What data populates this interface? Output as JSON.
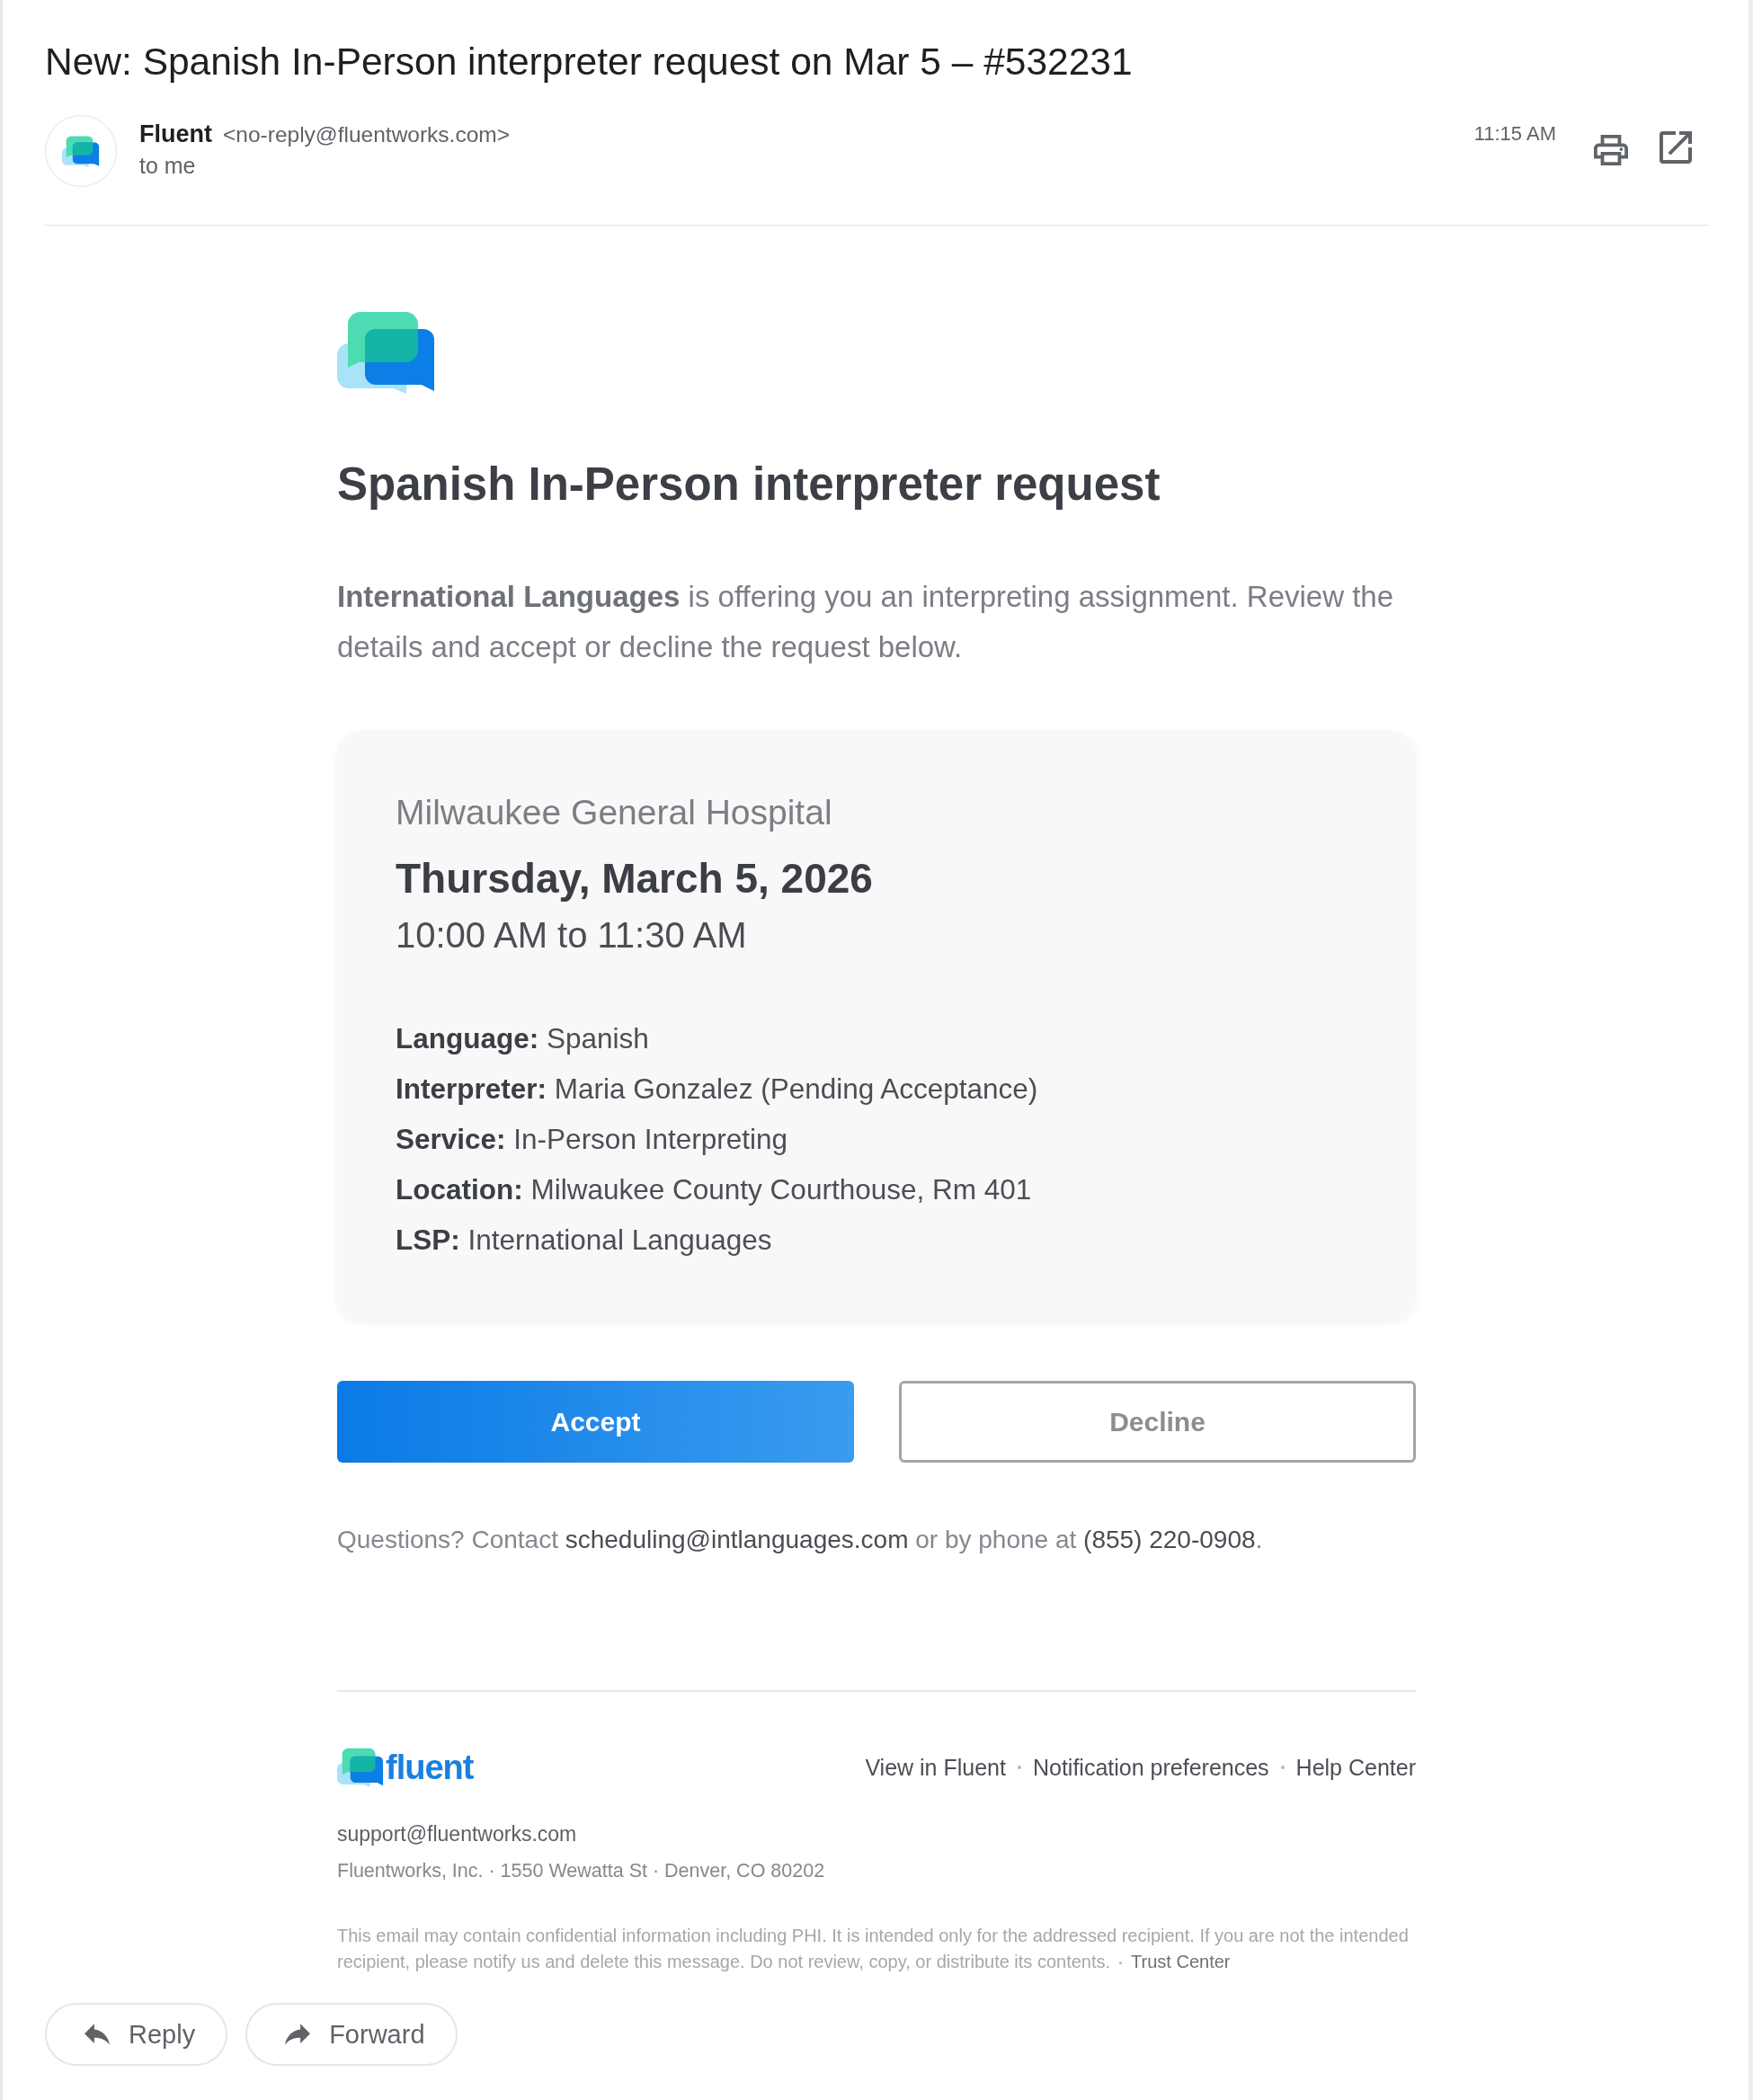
{
  "email": {
    "subject": "New: Spanish In-Person interpreter request on Mar 5 – #532231",
    "sender": {
      "name": "Fluent",
      "address": "<no-reply@fluentworks.com>",
      "recipient": "to me"
    },
    "time": "11:15 AM"
  },
  "body": {
    "title": "Spanish In-Person interpreter request",
    "intro": "**International Languages** is offering you an interpreting assignment. Review the details and accept or decline the request below.",
    "card": {
      "facility": "Milwaukee General Hospital",
      "date": "Thursday, March 5, 2026",
      "time": "10:00 AM to 11:30 AM",
      "details": [
        "**Language:** Spanish",
        "**Interpreter:** Maria Gonzalez (Pending Acceptance)",
        "**Service:** In-Person Interpreting",
        "**Location:** Milwaukee County Courthouse, Rm 401",
        "**LSP:** International Languages"
      ]
    },
    "actions": [
      {
        "kind": "accept",
        "label": "Accept"
      },
      {
        "kind": "decline",
        "label": "Decline"
      }
    ],
    "contact": [
      {
        "kind": "text",
        "text": "Questions? Contact "
      },
      {
        "kind": "email",
        "text": "scheduling@intlanguages.com"
      },
      {
        "kind": "text",
        "text": " or by phone at "
      },
      {
        "kind": "phone",
        "text": "(855) 220-0908"
      },
      {
        "kind": "text",
        "text": "."
      }
    ]
  },
  "footer": {
    "wordmark": "fluent",
    "links": [
      "View in Fluent",
      "Notification preferences",
      "Help Center"
    ],
    "support_email": "support@fluentworks.com",
    "address": "Fluentworks, Inc. · 1550 Wewatta St · Denver, CO 80202",
    "disclaimer": "This email may contain confidential information including PHI. It is intended only for the addressed recipient. If you are not the intended recipient, please notify us and delete this message. Do not review, copy, or distribute its contents.",
    "disclaimer_link": "Trust Center"
  },
  "reply_actions": [
    {
      "kind": "reply",
      "label": "Reply"
    },
    {
      "kind": "forward",
      "label": "Forward"
    }
  ]
}
